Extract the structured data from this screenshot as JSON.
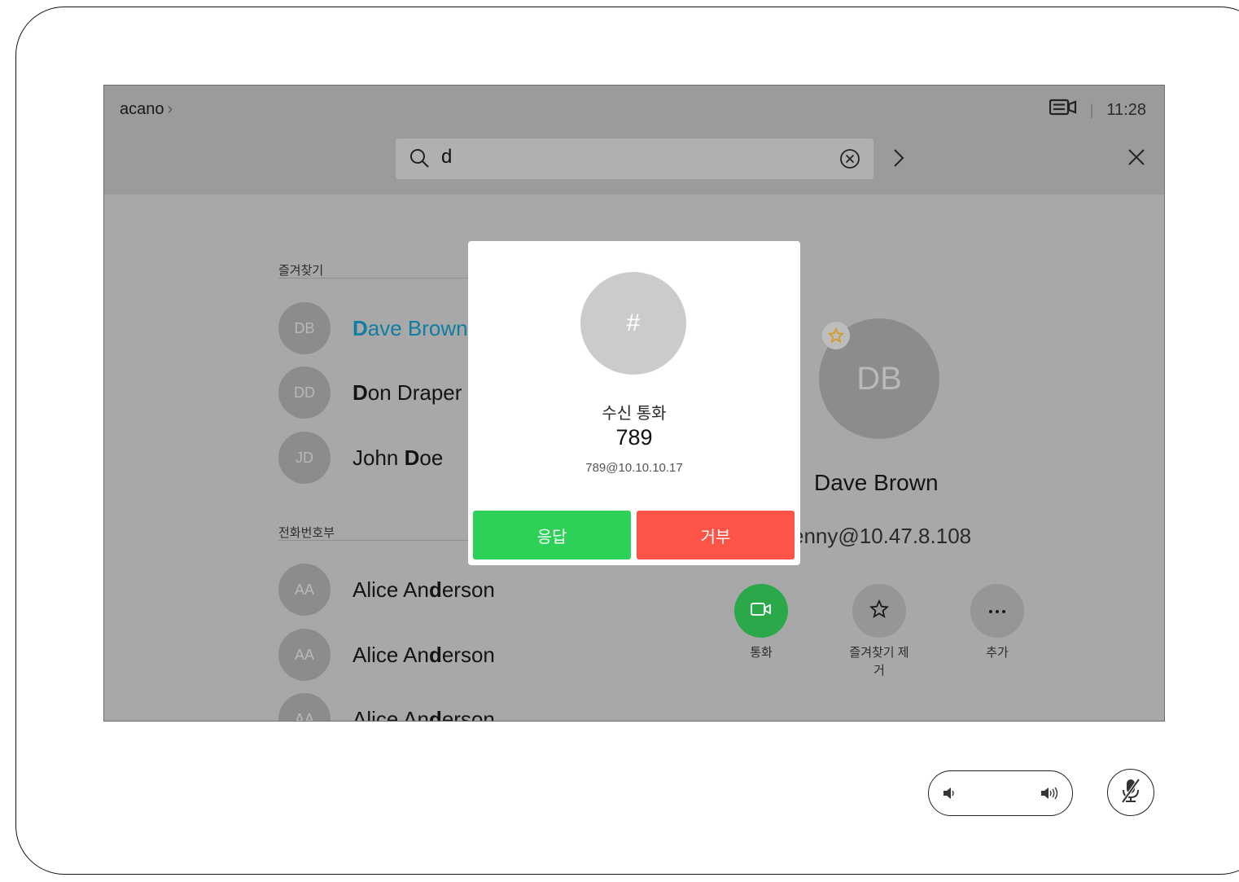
{
  "header": {
    "brand": "acano",
    "brand_chevron": "›",
    "time": "11:28",
    "separator": "|",
    "layout_icon": "layout-icon"
  },
  "search": {
    "value": "d",
    "icons": [
      "search-icon",
      "clear-icon",
      "chevron-right-icon",
      "close-icon"
    ]
  },
  "favorites": {
    "heading": "즐겨찾기",
    "items": [
      {
        "initials": "DB",
        "name": "Dave Brown",
        "bold": "D",
        "rest": "ave Brown",
        "selected": true
      },
      {
        "initials": "DD",
        "name": "Don Draper",
        "bold": "D",
        "rest": "on Draper",
        "selected": false
      },
      {
        "initials": "JD",
        "name": "John Doe",
        "pre": "John ",
        "bold": "D",
        "rest": "oe",
        "selected": false
      }
    ]
  },
  "directory": {
    "heading": "전화번호부",
    "items": [
      {
        "initials": "AA",
        "pre": "Alice An",
        "bold": "d",
        "rest": "erson"
      },
      {
        "initials": "AA",
        "pre": "Alice An",
        "bold": "d",
        "rest": "erson"
      },
      {
        "initials": "AA",
        "pre": "Alice An",
        "bold": "d",
        "rest": "erson"
      }
    ]
  },
  "detail": {
    "initials": "DB",
    "name": "Dave Brown",
    "address": "enny@10.47.8.108",
    "actions": [
      {
        "label": "통화",
        "icon": "video-call-icon",
        "color": "#2aa84a"
      },
      {
        "label": "즐겨찾기 제\n거",
        "icon": "star-icon",
        "color": "#969696"
      },
      {
        "label": "추가",
        "icon": "more-icon",
        "color": "#969696"
      }
    ]
  },
  "incoming_call": {
    "avatar_text": "#",
    "title": "수신 통화",
    "number": "789",
    "address": "789@10.10.10.17",
    "answer_label": "응답",
    "decline_label": "거부",
    "answer_color": "#2ed158",
    "decline_color": "#fe5447"
  },
  "controls": {
    "volume_icons": [
      "volume-down-icon",
      "volume-up-icon"
    ],
    "mute_icon": "microphone-muted-icon"
  }
}
